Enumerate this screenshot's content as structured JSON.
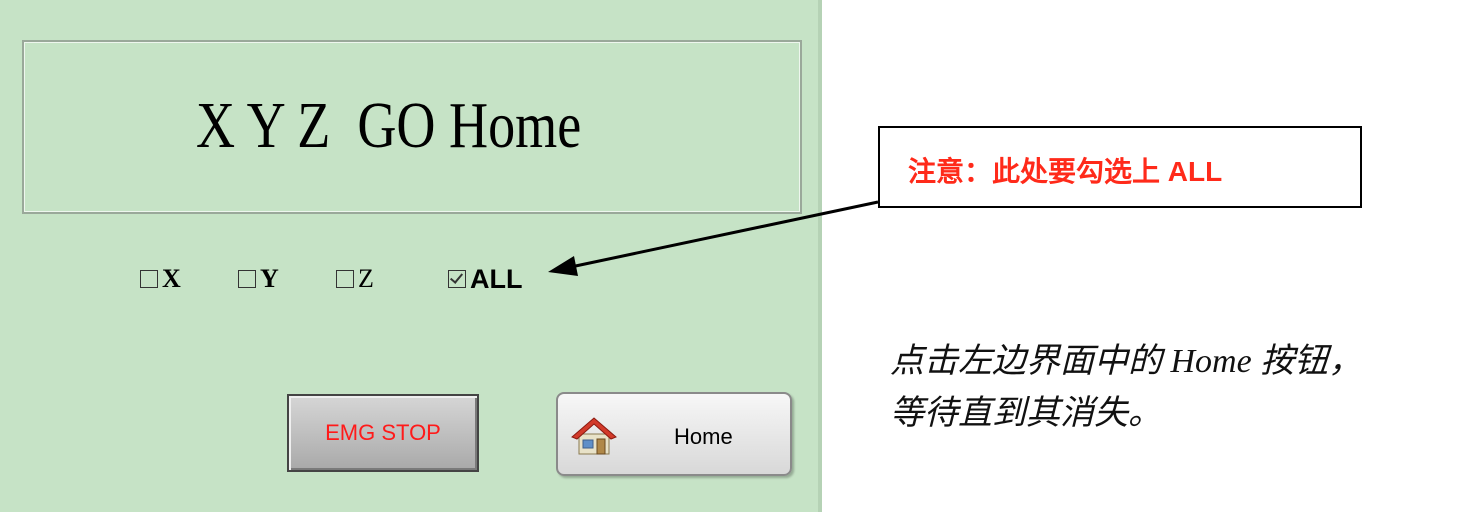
{
  "panel": {
    "title": "X Y Z  GO Home",
    "checkboxes": [
      {
        "label": "X",
        "checked": false
      },
      {
        "label": "Y",
        "checked": false
      },
      {
        "label": "Z",
        "checked": false
      },
      {
        "label": "ALL",
        "checked": true
      }
    ],
    "emg_button_label": "EMG STOP",
    "home_button_label": "Home",
    "home_button_icon": "house-icon"
  },
  "annotation": {
    "callout_text": "注意：此处要勾选上 ALL",
    "instruction_line1": "点击左边界面中的 Home 按钮，",
    "instruction_line2": "等待直到其消失。"
  },
  "colors": {
    "panel_background": "#c6e3c6",
    "emg_text": "#ff1a1a",
    "callout_text": "#ff2a1a"
  }
}
